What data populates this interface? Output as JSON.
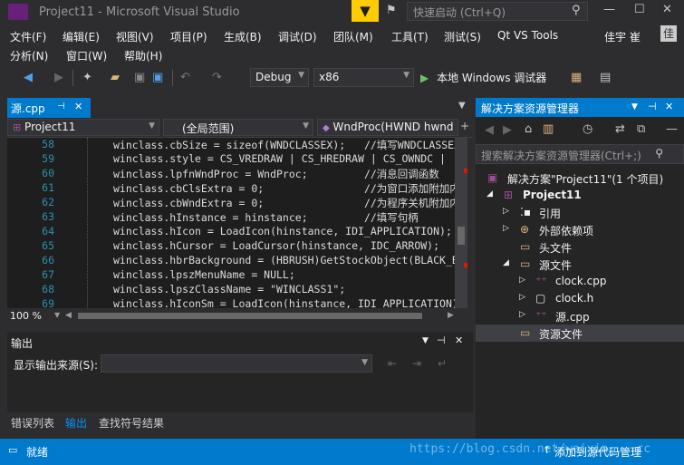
{
  "window": {
    "title": "Project11 - Microsoft Visual Studio",
    "quick_launch_placeholder": "快速启动 (Ctrl+Q)",
    "user": "佳宇 崔",
    "user_initial": "佳"
  },
  "menu": [
    "文件(F)",
    "编辑(E)",
    "视图(V)",
    "项目(P)",
    "生成(B)",
    "调试(D)",
    "团队(M)",
    "工具(T)",
    "测试(S)",
    "Qt VS Tools",
    "分析(N)",
    "窗口(W)",
    "帮助(H)"
  ],
  "toolbar": {
    "config": "Debug",
    "platform": "x86",
    "run_label": "本地 Windows 调试器"
  },
  "editor": {
    "tab_label": "源.cpp",
    "nav_project": "Project11",
    "nav_scope": "(全局范围)",
    "nav_function": "WndProc(HWND hwnd",
    "zoom": "100 %",
    "lines": [
      {
        "num": "58",
        "text": "winclass.cbSize = sizeof(WNDCLASSEX);   //填写WNDCLASSEX结构"
      },
      {
        "num": "59",
        "text": "winclass.style = CS_VREDRAW | CS_HREDRAW | CS_OWNDC |"
      },
      {
        "num": "60",
        "text": "winclass.lpfnWndProc = WndProc;         //消息回调函数"
      },
      {
        "num": "61",
        "text": "winclass.cbClsExtra = 0;                //为窗口添加附加内存"
      },
      {
        "num": "62",
        "text": "winclass.cbWndExtra = 0;                //为程序关机附加内存"
      },
      {
        "num": "63",
        "text": "winclass.hInstance = hinstance;         //填写句柄"
      },
      {
        "num": "64",
        "text": "winclass.hIcon = LoadIcon(hinstance, IDI_APPLICATION);"
      },
      {
        "num": "65",
        "text": "winclass.hCursor = LoadCursor(hinstance, IDC_ARROW);"
      },
      {
        "num": "66",
        "text": "winclass.hbrBackground = (HBRUSH)GetStockObject(BLACK_BRUSH);"
      },
      {
        "num": "67",
        "text": "winclass.lpszMenuName = NULL;                          //"
      },
      {
        "num": "68",
        "text": "winclass.lpszClassName = \"WINCLASS1\";                  //"
      },
      {
        "num": "69",
        "text": "winclass.hIconSm = LoadIcon(hinstance, IDI_APPLICATION);"
      }
    ]
  },
  "output": {
    "title": "输出",
    "source_label": "显示输出来源(S):"
  },
  "bottom_tabs": [
    "错误列表",
    "输出",
    "查找符号结果"
  ],
  "solution_explorer": {
    "title": "解决方案资源管理器",
    "search_placeholder": "搜索解决方案资源管理器(Ctrl+;)",
    "solution": "解决方案\"Project11\"(1 个项目)",
    "project": "Project11",
    "nodes": [
      "引用",
      "外部依赖项",
      "头文件",
      "源文件",
      "clock.cpp",
      "clock.h",
      "源.cpp",
      "资源文件"
    ]
  },
  "status": {
    "text": "就绪",
    "watermark": "https://blog.csdn.net/weixin_...cc",
    "source_control": "添加到源代码管理"
  }
}
